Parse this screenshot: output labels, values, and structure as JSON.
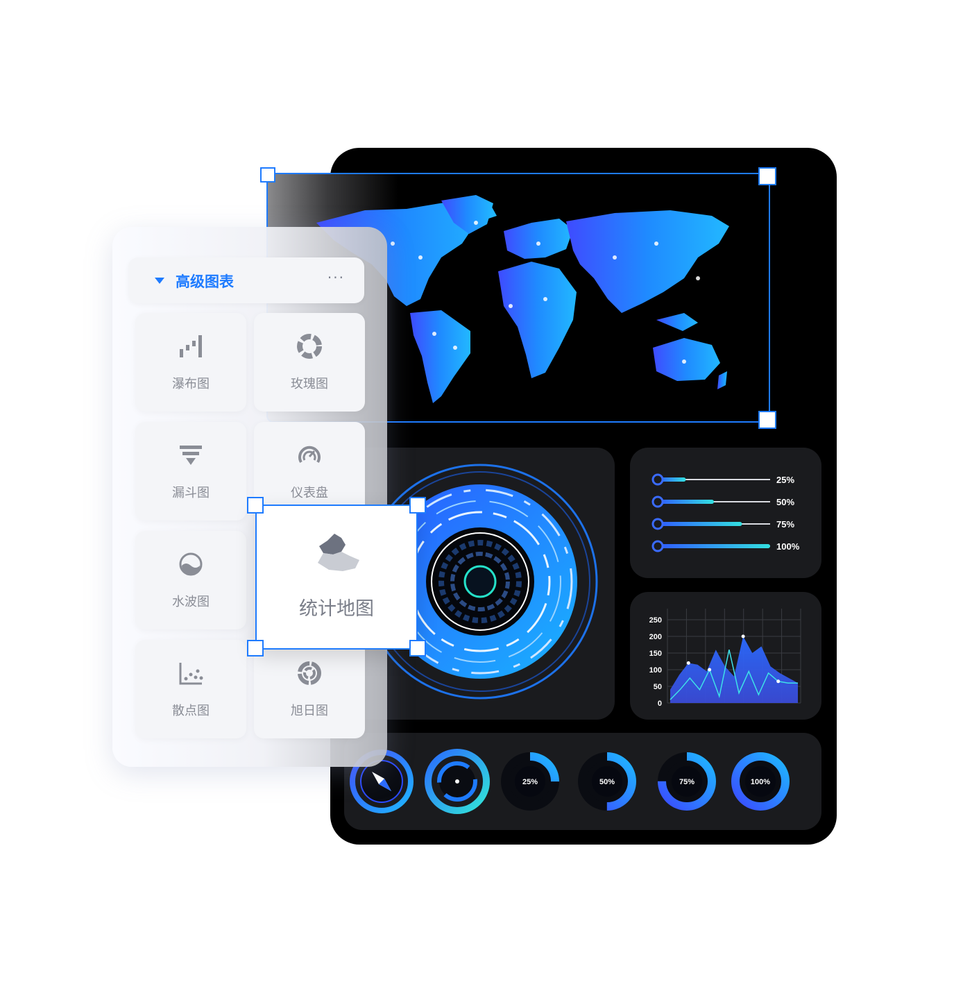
{
  "panel": {
    "title": "高级图表",
    "more": "···",
    "tiles": [
      {
        "label": "瀑布图",
        "icon": "waterfall-chart-icon"
      },
      {
        "label": "玫瑰图",
        "icon": "rose-chart-icon"
      },
      {
        "label": "漏斗图",
        "icon": "funnel-chart-icon"
      },
      {
        "label": "仪表盘",
        "icon": "gauge-icon"
      },
      {
        "label": "水波图",
        "icon": "liquid-fill-icon"
      },
      {
        "label": "散点图",
        "icon": "scatter-chart-icon"
      },
      {
        "label": "旭日图",
        "icon": "sunburst-chart-icon"
      }
    ],
    "selected": {
      "label": "统计地图",
      "icon": "region-map-icon"
    }
  },
  "progress": {
    "items": [
      {
        "label": "25%",
        "value": 0.25
      },
      {
        "label": "50%",
        "value": 0.5
      },
      {
        "label": "75%",
        "value": 0.75
      },
      {
        "label": "100%",
        "value": 1.0
      }
    ]
  },
  "chart_data": {
    "type": "area",
    "y_ticks": [
      "250",
      "200",
      "150",
      "100",
      "50",
      "0"
    ],
    "ylim": [
      0,
      250
    ],
    "series": [
      {
        "values": [
          40,
          85,
          120,
          115,
          95,
          160,
          110,
          80,
          200,
          150,
          170,
          110,
          90,
          75,
          60
        ]
      },
      {
        "values": [
          10,
          40,
          75,
          40,
          100,
          20,
          160,
          30,
          95,
          25,
          90,
          65,
          60,
          60
        ]
      }
    ]
  },
  "rings": [
    {
      "label": "",
      "icon": "compass-icon"
    },
    {
      "label": "",
      "icon": "radar-ring-icon"
    },
    {
      "label": "25%",
      "value": 0.25
    },
    {
      "label": "50%",
      "value": 0.5
    },
    {
      "label": "75%",
      "value": 0.75
    },
    {
      "label": "100%",
      "value": 1.0
    }
  ],
  "colors": {
    "accent": "#1e7bff",
    "dark_bg": "#000000",
    "card_bg": "#1a1b1e"
  }
}
